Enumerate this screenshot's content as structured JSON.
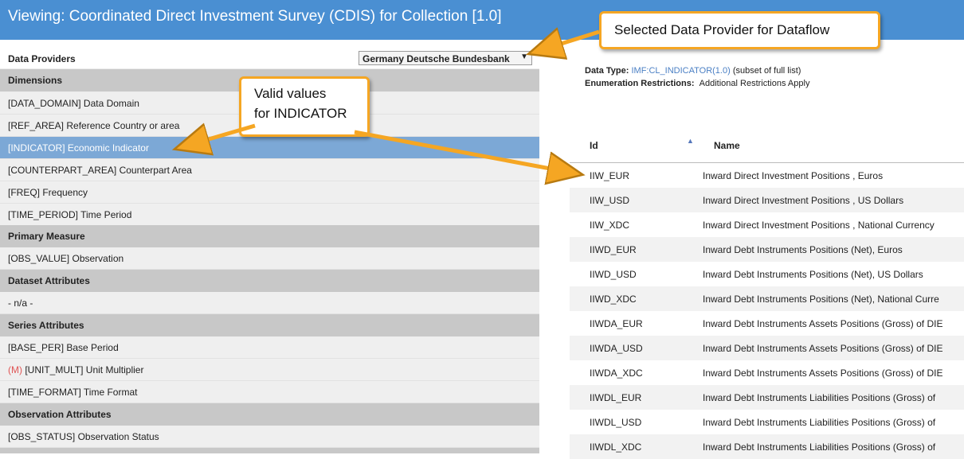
{
  "header": {
    "title": "Viewing: Coordinated Direct Investment Survey (CDIS) for Collection [1.0]"
  },
  "providers": {
    "label": "Data Providers",
    "selected": "Germany Deutsche Bundesbank",
    "arrow": "▼"
  },
  "sections": {
    "dimensions": "Dimensions",
    "primary": "Primary Measure",
    "dataset": "Dataset Attributes",
    "series": "Series Attributes",
    "observation": "Observation Attributes"
  },
  "items": {
    "data_domain": "[DATA_DOMAIN] Data Domain",
    "ref_area": "[REF_AREA] Reference Country or area",
    "indicator": "[INDICATOR] Economic Indicator",
    "counterpart": "[COUNTERPART_AREA] Counterpart Area",
    "freq": "[FREQ] Frequency",
    "time_period": "[TIME_PERIOD] Time Period",
    "obs_value": "[OBS_VALUE] Observation",
    "na": "- n/a -",
    "base_per": "[BASE_PER] Base Period",
    "unit_mult_flag": "(M)",
    "unit_mult": " [UNIT_MULT] Unit Multiplier",
    "time_format": "[TIME_FORMAT] Time Format",
    "obs_status": "[OBS_STATUS] Observation Status"
  },
  "meta": {
    "datatype_label": "Data Type:",
    "datatype_link": "IMF:CL_INDICATOR(1.0)",
    "datatype_note": "(subset of full list)",
    "enum_label": "Enumeration Restrictions:",
    "enum_value": "Additional Restrictions Apply"
  },
  "table": {
    "col_id": "Id",
    "col_name": "Name",
    "sort_glyph": "▲",
    "rows": [
      {
        "id": "IIW_EUR",
        "name": "Inward Direct Investment Positions , Euros"
      },
      {
        "id": "IIW_USD",
        "name": "Inward Direct Investment Positions , US Dollars"
      },
      {
        "id": "IIW_XDC",
        "name": "Inward Direct Investment Positions , National Currency"
      },
      {
        "id": "IIWD_EUR",
        "name": "Inward Debt Instruments Positions (Net), Euros"
      },
      {
        "id": "IIWD_USD",
        "name": "Inward Debt Instruments Positions (Net), US Dollars"
      },
      {
        "id": "IIWD_XDC",
        "name": "Inward Debt Instruments Positions (Net), National Curre"
      },
      {
        "id": "IIWDA_EUR",
        "name": "Inward Debt Instruments Assets Positions (Gross) of DIE"
      },
      {
        "id": "IIWDA_USD",
        "name": "Inward Debt Instruments Assets Positions (Gross) of DIE"
      },
      {
        "id": "IIWDA_XDC",
        "name": "Inward Debt Instruments Assets Positions (Gross) of DIE"
      },
      {
        "id": "IIWDL_EUR",
        "name": "Inward Debt Instruments Liabilities Positions (Gross) of"
      },
      {
        "id": "IIWDL_USD",
        "name": "Inward Debt Instruments Liabilities Positions (Gross) of"
      },
      {
        "id": "IIWDL_XDC",
        "name": "Inward Debt Instruments Liabilities Positions (Gross) of"
      }
    ]
  },
  "callouts": {
    "provider": "Selected Data Provider for Dataflow",
    "valid_line1": "Valid values",
    "valid_line2": "for INDICATOR"
  },
  "colors": {
    "header_blue": "#4a8fd2",
    "selected_row": "#7ca8d6",
    "callout_border": "#f5a623"
  }
}
